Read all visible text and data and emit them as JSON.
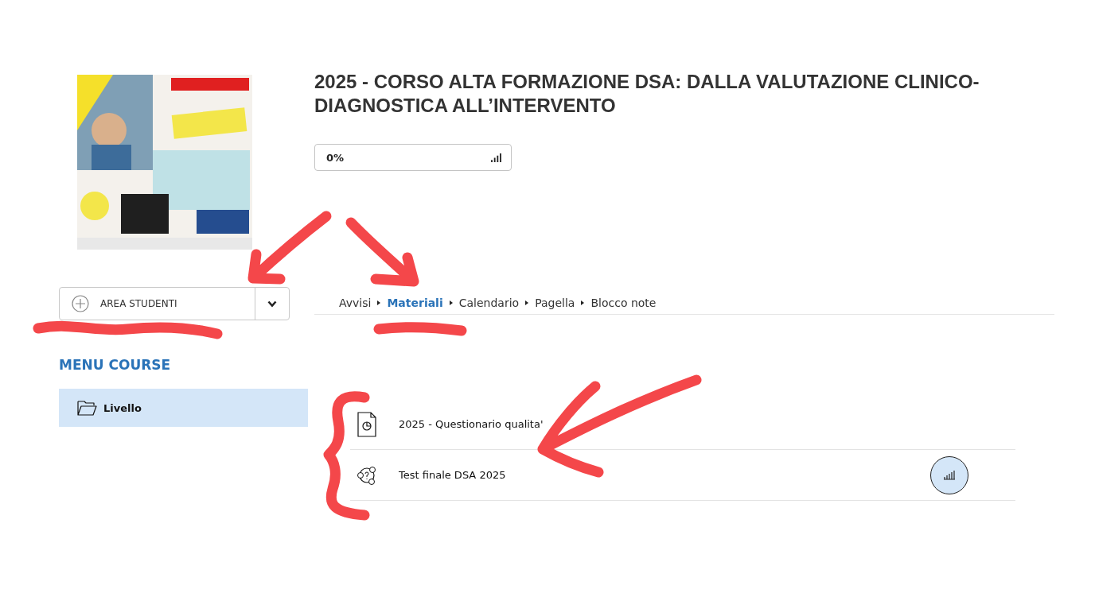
{
  "course": {
    "title": "2025 - CORSO ALTA FORMAZIONE DSA: DALLA VALUTAZIONE CLINICO-DIAGNOSTICA ALL’INTERVENTO",
    "progress": "0%"
  },
  "area_menu": {
    "label": "AREA STUDENTI"
  },
  "menu_course": {
    "heading": "MENU COURSE",
    "items": [
      {
        "label": "Livello",
        "selected": true
      }
    ]
  },
  "tabs": [
    {
      "label": "Avvisi",
      "selected": false
    },
    {
      "label": "Materiali",
      "selected": true
    },
    {
      "label": "Calendario",
      "selected": false
    },
    {
      "label": "Pagella",
      "selected": false
    },
    {
      "label": "Blocco note",
      "selected": false
    }
  ],
  "materials": [
    {
      "kind": "questionnaire",
      "title": "2025 - Questionario qualita'",
      "stats": false
    },
    {
      "kind": "test",
      "title": "Test finale DSA 2025",
      "stats": true
    }
  ]
}
